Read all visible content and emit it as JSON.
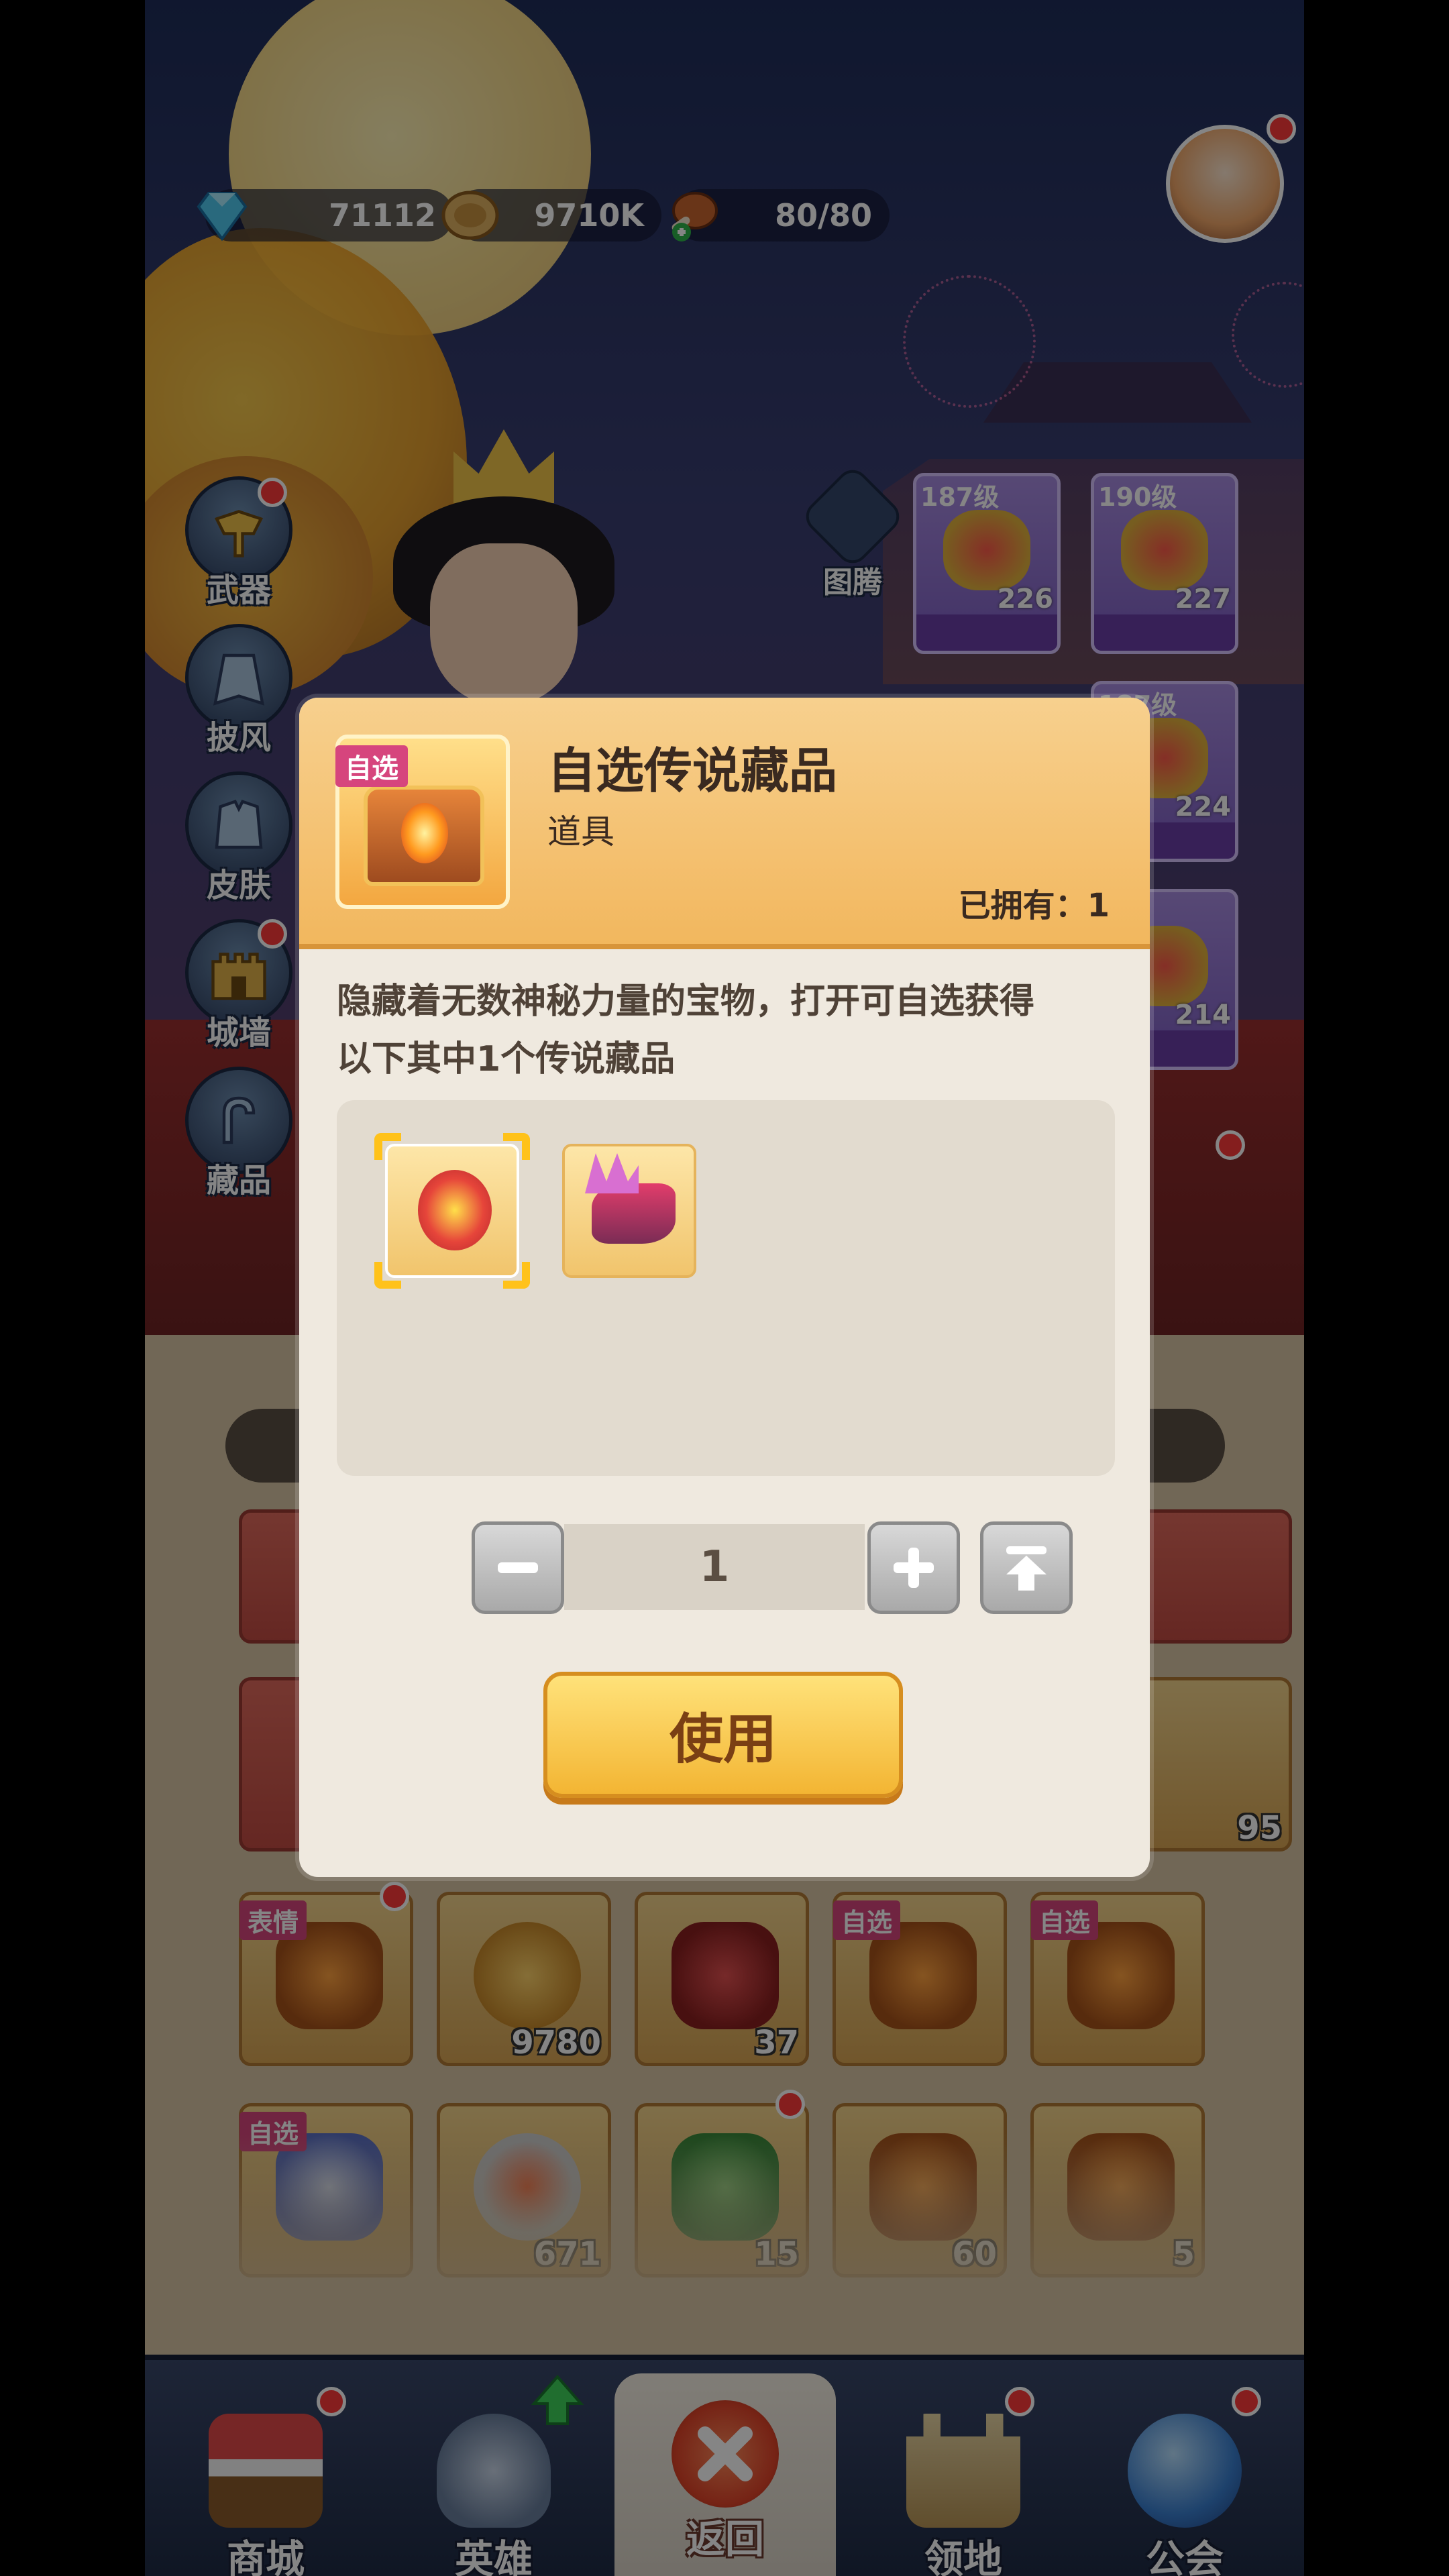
{
  "resources": {
    "diamonds": "71112",
    "coins": "9710K",
    "stamina": "80/80"
  },
  "left_menu": [
    {
      "label": "武器",
      "icon": "weapon-icon",
      "badge": true
    },
    {
      "label": "披风",
      "icon": "cape-icon",
      "badge": false
    },
    {
      "label": "皮肤",
      "icon": "skin-icon",
      "badge": false
    },
    {
      "label": "城墙",
      "icon": "wall-icon",
      "badge": true
    },
    {
      "label": "藏品",
      "icon": "collection-icon",
      "badge": false
    }
  ],
  "totem": {
    "label": "图腾"
  },
  "equip_cards": [
    {
      "level": "187级",
      "power": "226"
    },
    {
      "level": "190级",
      "power": "227"
    },
    {
      "level": "187级",
      "power": "224"
    },
    {
      "level": "",
      "power": "214"
    }
  ],
  "inventory": {
    "row1": [
      {
        "tag": "表情",
        "count": ""
      },
      {
        "tag": "",
        "count": "9780"
      },
      {
        "tag": "",
        "count": "37"
      },
      {
        "tag": "自选",
        "count": ""
      },
      {
        "tag": "自选",
        "count": ""
      }
    ],
    "row2": [
      {
        "tag": "自选",
        "count": ""
      },
      {
        "tag": "",
        "count": "671"
      },
      {
        "tag": "",
        "count": "15"
      },
      {
        "tag": "",
        "count": "60"
      },
      {
        "tag": "",
        "count": "5"
      }
    ],
    "partial_count": "95"
  },
  "modal": {
    "tag": "自选",
    "title": "自选传说藏品",
    "subtitle": "道具",
    "owned": "已拥有：1",
    "description_line1": "隐藏着无数神秘力量的宝物，打开可自选获得",
    "description_line2": "以下其中1个传说藏品",
    "quantity": "1",
    "use_label": "使用"
  },
  "nav": [
    {
      "label": "商城",
      "badge": true
    },
    {
      "label": "英雄",
      "badge": false
    },
    {
      "label": "返回",
      "badge": false
    },
    {
      "label": "领地",
      "badge": true
    },
    {
      "label": "公会",
      "badge": true
    }
  ],
  "colors": {
    "accent_gold": "#f3b533",
    "badge_red": "#ff3b3b",
    "tag_pink": "#d6457d"
  }
}
